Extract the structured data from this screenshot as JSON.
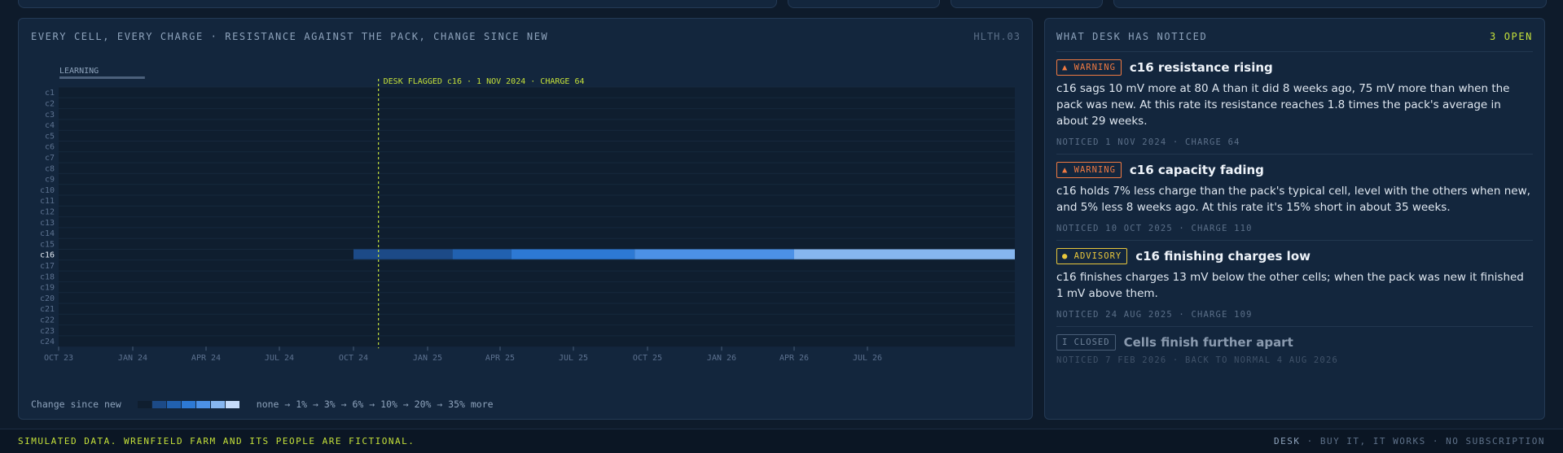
{
  "heat_panel": {
    "title": "EVERY CELL, EVERY CHARGE · RESISTANCE AGAINST THE PACK, CHANGE SINCE NEW",
    "code": "HLTH.03",
    "learning_label": "LEARNING",
    "flag_label": "DESK FLAGGED c16 · 1 NOV 2024 · CHARGE 64",
    "legend_title": "Change since new",
    "legend_scale": "none → 1% → 3% → 6% → 10% → 20% → 35% more",
    "legend_colors": [
      "#0f1e2f",
      "#1c4a87",
      "#2161b0",
      "#2d79d4",
      "#4c91e6",
      "#86b6ef",
      "#c6dcfa"
    ]
  },
  "chart_data": {
    "type": "heatmap",
    "cells": [
      "c1",
      "c2",
      "c3",
      "c4",
      "c5",
      "c6",
      "c7",
      "c8",
      "c9",
      "c10",
      "c11",
      "c12",
      "c13",
      "c14",
      "c15",
      "c16",
      "c17",
      "c18",
      "c19",
      "c20",
      "c21",
      "c22",
      "c23",
      "c24"
    ],
    "highlighted_cell": "c16",
    "x_range": [
      "2023-10-01",
      "2026-12-31"
    ],
    "x_ticks": [
      {
        "date": "2023-10-01",
        "label": "OCT 23"
      },
      {
        "date": "2024-01-01",
        "label": "JAN 24"
      },
      {
        "date": "2024-04-01",
        "label": "APR 24"
      },
      {
        "date": "2024-07-01",
        "label": "JUL 24"
      },
      {
        "date": "2024-10-01",
        "label": "OCT 24"
      },
      {
        "date": "2025-01-01",
        "label": "JAN 25"
      },
      {
        "date": "2025-04-01",
        "label": "APR 25"
      },
      {
        "date": "2025-07-01",
        "label": "JUL 25"
      },
      {
        "date": "2025-10-01",
        "label": "OCT 25"
      },
      {
        "date": "2026-01-01",
        "label": "JAN 26"
      },
      {
        "date": "2026-04-01",
        "label": "APR 26"
      },
      {
        "date": "2026-07-01",
        "label": "JUL 26"
      }
    ],
    "learning_period": [
      "2023-10-01",
      "2024-01-15"
    ],
    "flag_date": "2024-11-01",
    "segments": [
      {
        "cell": "c16",
        "start": "2024-10-01",
        "end": "2025-02-01",
        "change_pct": 1
      },
      {
        "cell": "c16",
        "start": "2025-02-01",
        "end": "2025-04-15",
        "change_pct": 3
      },
      {
        "cell": "c16",
        "start": "2025-04-15",
        "end": "2025-09-15",
        "change_pct": 6
      },
      {
        "cell": "c16",
        "start": "2025-09-15",
        "end": "2026-04-01",
        "change_pct": 10
      },
      {
        "cell": "c16",
        "start": "2026-04-01",
        "end": "2026-12-31",
        "change_pct": 20
      }
    ]
  },
  "notices_panel": {
    "title": "WHAT DESK HAS NOTICED",
    "count": "3 OPEN",
    "items": [
      {
        "badge": "▲ WARNING",
        "level": "warning",
        "title": "c16 resistance rising",
        "body": "c16 sags 10 mV more at 80 A than it did 8 weeks ago, 75 mV more than when the pack was new. At this rate its resistance reaches 1.8 times the pack's average in about 29 weeks.",
        "meta": "NOTICED 1 NOV 2024 · CHARGE 64"
      },
      {
        "badge": "▲ WARNING",
        "level": "warning",
        "title": "c16 capacity fading",
        "body": "c16 holds 7% less charge than the pack's typical cell, level with the others when new, and 5% less 8 weeks ago. At this rate it's 15% short in about 35 weeks.",
        "meta": "NOTICED 10 OCT 2025 · CHARGE 110"
      },
      {
        "badge": "● ADVISORY",
        "level": "advisory",
        "title": "c16 finishing charges low",
        "body": "c16 finishes charges 13 mV below the other cells; when the pack was new it finished 1 mV above them.",
        "meta": "NOTICED 24 AUG 2025 · CHARGE 109"
      },
      {
        "badge": "I CLOSED",
        "level": "closed",
        "title": "Cells finish further apart",
        "body": "",
        "meta": "NOTICED 7 FEB 2026 · BACK TO NORMAL 4 AUG 2026"
      }
    ]
  },
  "footer": {
    "disclaimer": "SIMULATED DATA. WRENFIELD FARM AND ITS PEOPLE ARE FICTIONAL.",
    "brand": "DESK",
    "tagline": " · BUY IT, IT WORKS · NO SUBSCRIPTION"
  },
  "colors": {
    "accent": "#c4e03a",
    "warning": "#f07a42",
    "advisory": "#e8c73c",
    "panel": "#13263d",
    "background": "#0e1b2b"
  }
}
